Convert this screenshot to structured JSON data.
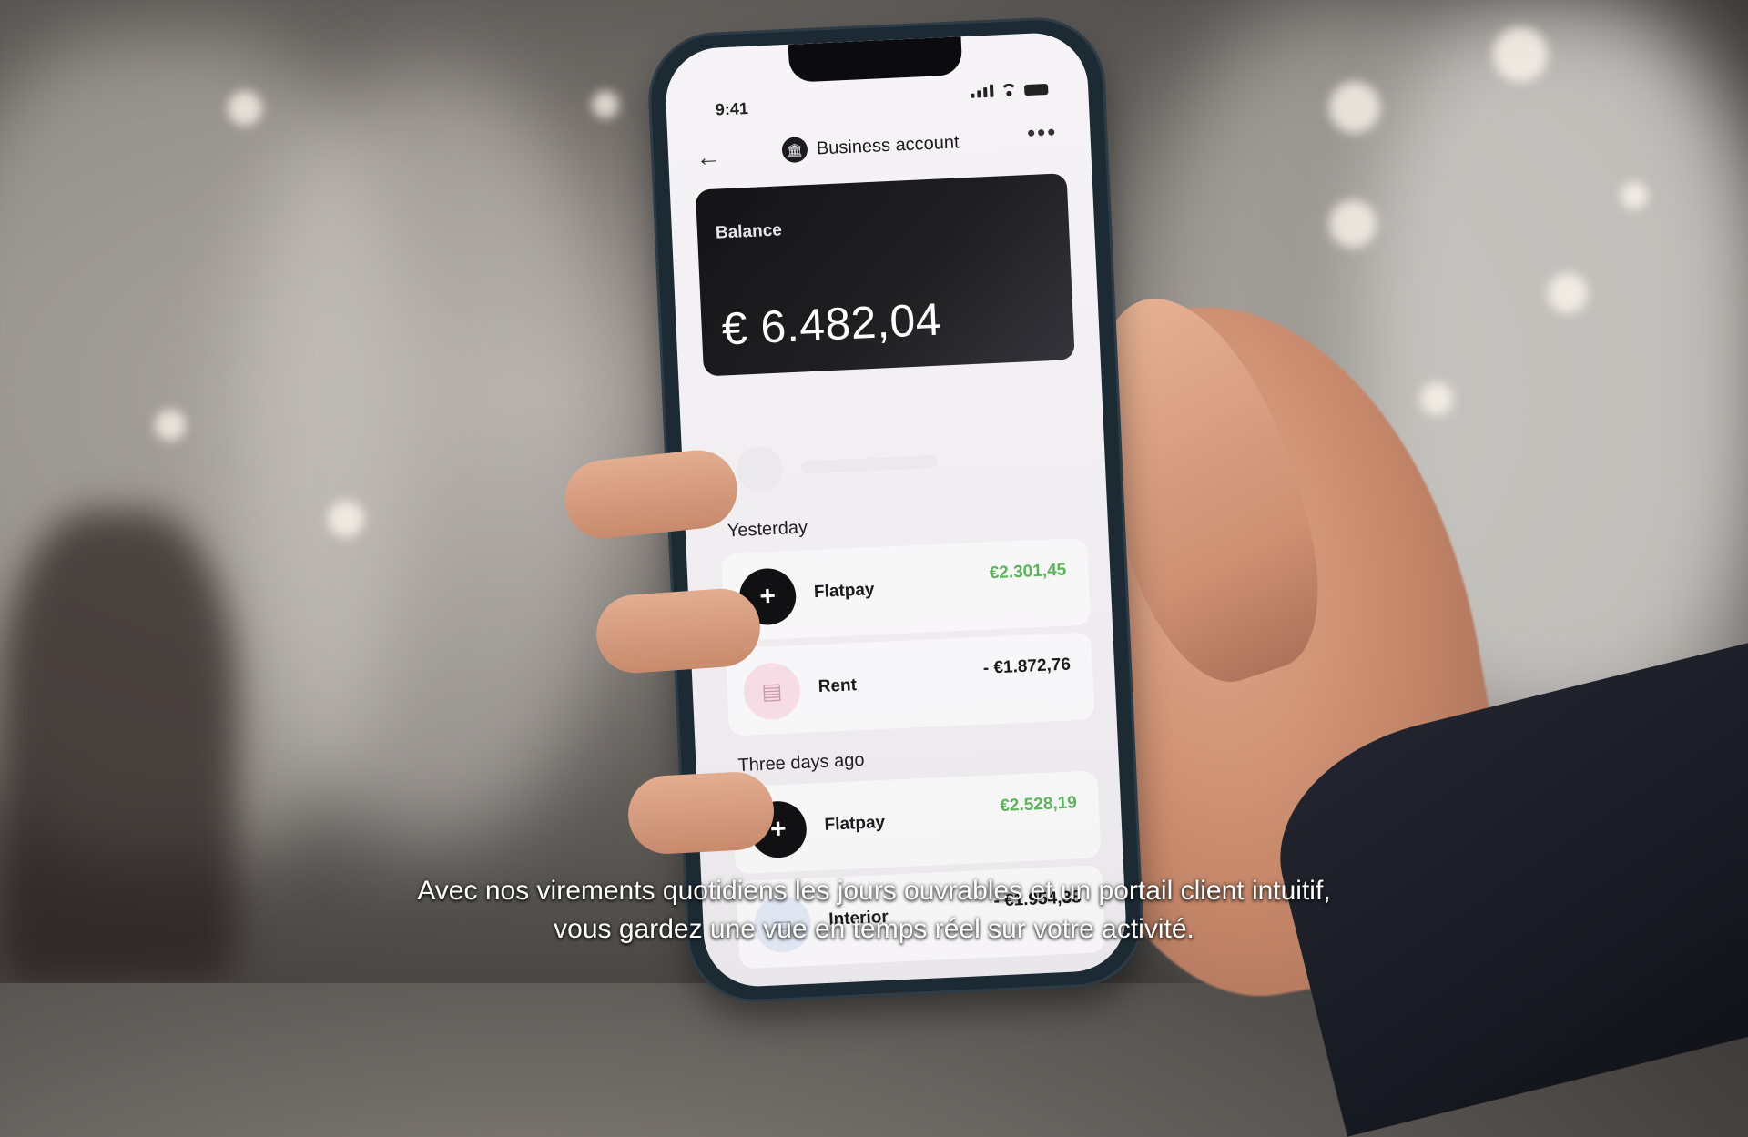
{
  "status_bar": {
    "time": "9:41"
  },
  "header": {
    "title": "Business account",
    "back_glyph": "←",
    "more_glyph": "•••",
    "account_icon": "bank-icon"
  },
  "balance_card": {
    "label": "Balance",
    "amount": "€ 6.482,04"
  },
  "groups": [
    {
      "heading": "Yesterday",
      "items": [
        {
          "name": "Flatpay",
          "amount": "€2.301,45",
          "kind": "credit",
          "icon": "flatpay-logo-icon"
        },
        {
          "name": "Rent",
          "amount": "- €1.872,76",
          "kind": "debit",
          "icon": "building-icon"
        }
      ]
    },
    {
      "heading": "Three days ago",
      "items": [
        {
          "name": "Flatpay",
          "amount": "€2.528,19",
          "kind": "credit",
          "icon": "flatpay-logo-icon"
        },
        {
          "name": "Interior",
          "amount": "- €1.954,38",
          "kind": "debit",
          "icon": "sofa-icon"
        }
      ]
    }
  ],
  "subtitles": {
    "line1": "Avec nos virements quotidiens les jours ouvrables et un portail client intuitif,",
    "line2": "vous gardez une vue en temps réel sur votre activité."
  },
  "colors": {
    "credit": "#5cb55a",
    "debit": "#1b1b1d",
    "card": "#141416"
  }
}
